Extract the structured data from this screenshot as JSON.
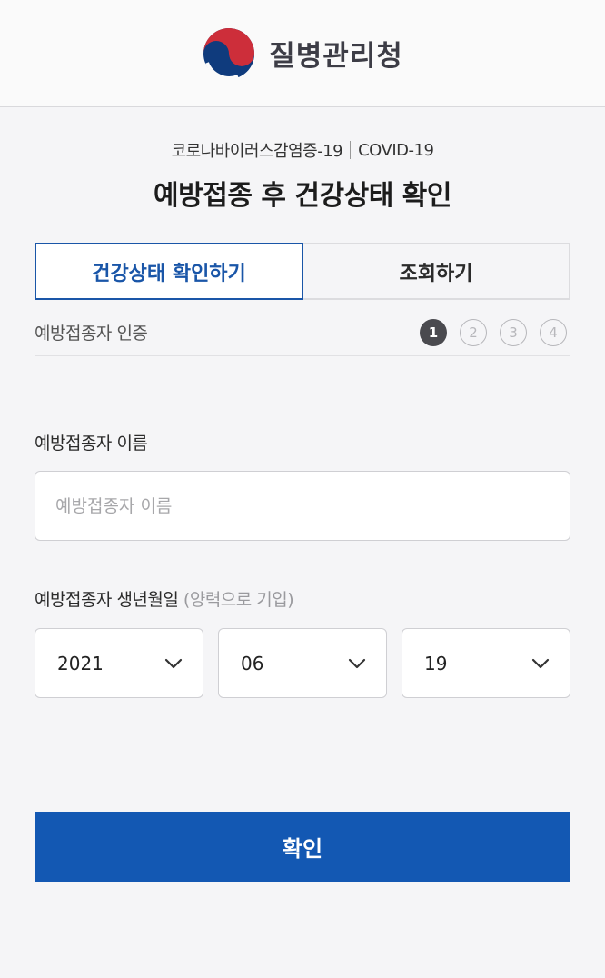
{
  "header": {
    "logo_icon": "taegeuk-logo-icon",
    "agency_name": "질병관리청",
    "colors": {
      "red": "#cd2e3a",
      "blue": "#0f3b7d"
    }
  },
  "breadcrumb": {
    "left": "코로나바이러스감염증-19",
    "right": "COVID-19"
  },
  "page_title": "예방접종 후 건강상태 확인",
  "tabs": [
    {
      "label": "건강상태 확인하기",
      "active": true
    },
    {
      "label": "조회하기",
      "active": false
    }
  ],
  "step_section": {
    "label": "예방접종자 인증",
    "steps": [
      "1",
      "2",
      "3",
      "4"
    ],
    "current_step": 1
  },
  "name_field": {
    "label": "예방접종자 이름",
    "placeholder": "예방접종자 이름",
    "value": ""
  },
  "birth_field": {
    "label": "예방접종자 생년월일",
    "hint": "(양력으로 기입)",
    "year": "2021",
    "month": "06",
    "day": "19",
    "chevron_icon": "chevron-down-icon"
  },
  "confirm_button": {
    "label": "확인",
    "color": "#1358b3"
  },
  "accent_color": "#1a56a8"
}
